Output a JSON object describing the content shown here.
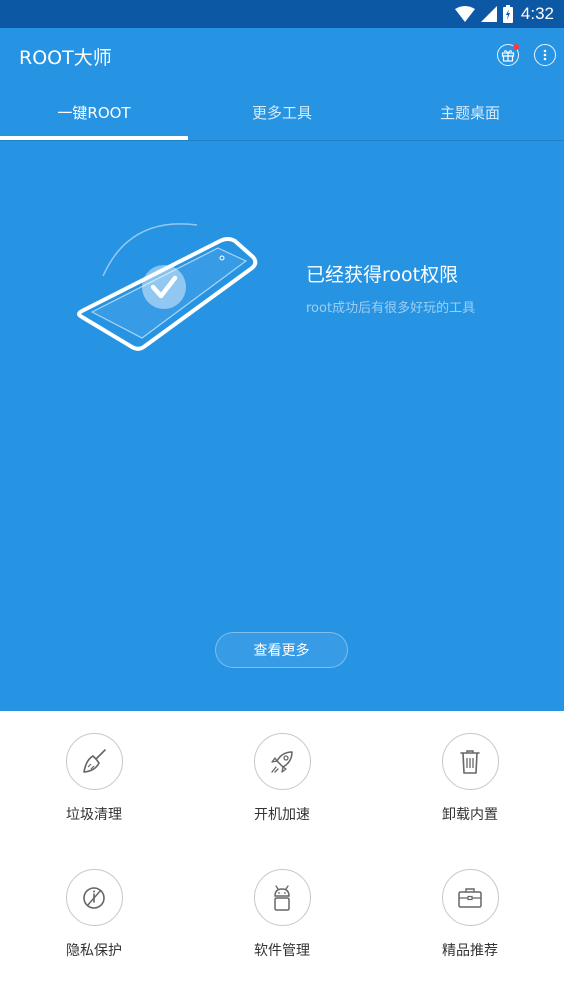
{
  "status_bar": {
    "time": "4:32"
  },
  "app_bar": {
    "title": "ROOT大师"
  },
  "tabs": [
    {
      "label": "一键ROOT",
      "active": true
    },
    {
      "label": "更多工具",
      "active": false
    },
    {
      "label": "主题桌面",
      "active": false
    }
  ],
  "hero": {
    "title": "已经获得root权限",
    "subtitle": "root成功后有很多好玩的工具",
    "more_button": "查看更多"
  },
  "tools": [
    {
      "label": "垃圾清理",
      "icon": "broom-icon"
    },
    {
      "label": "开机加速",
      "icon": "rocket-icon"
    },
    {
      "label": "卸载内置",
      "icon": "trash-icon"
    },
    {
      "label": "隐私保护",
      "icon": "privacy-icon"
    },
    {
      "label": "软件管理",
      "icon": "android-icon"
    },
    {
      "label": "精品推荐",
      "icon": "briefcase-icon"
    }
  ],
  "colors": {
    "primary": "#2693e3",
    "status_bar": "#0d58a5",
    "indicator": "#ffffff"
  }
}
